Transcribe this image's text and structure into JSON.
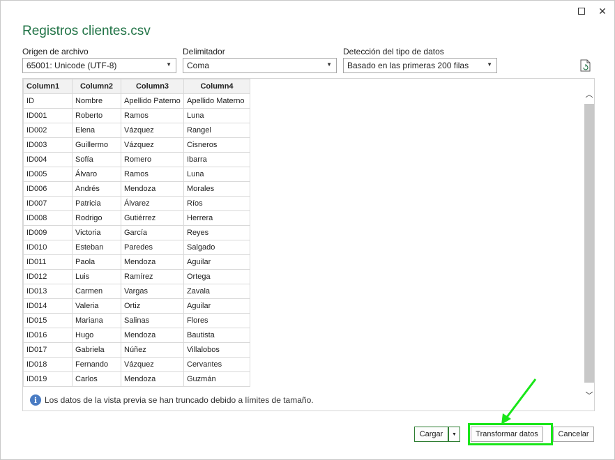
{
  "window": {
    "title": "Registros clientes.csv",
    "maximize_icon": "maximize-icon",
    "close_glyph": "✕"
  },
  "options": {
    "origin_label": "Origen de archivo",
    "origin_value": "65001: Unicode (UTF-8)",
    "delimiter_label": "Delimitador",
    "delimiter_value": "Coma",
    "detection_label": "Detección del tipo de datos",
    "detection_value": "Basado en las primeras 200 filas",
    "caret_glyph": "▼"
  },
  "table": {
    "headers": [
      "Column1",
      "Column2",
      "Column3",
      "Column4"
    ],
    "rows": [
      [
        "ID",
        "Nombre",
        "Apellido Paterno",
        "Apellido Materno"
      ],
      [
        "ID001",
        "Roberto",
        "Ramos",
        "Luna"
      ],
      [
        "ID002",
        "Elena",
        "Vázquez",
        "Rangel"
      ],
      [
        "ID003",
        "Guillermo",
        "Vázquez",
        "Cisneros"
      ],
      [
        "ID004",
        "Sofía",
        "Romero",
        "Ibarra"
      ],
      [
        "ID005",
        "Álvaro",
        "Ramos",
        "Luna"
      ],
      [
        "ID006",
        "Andrés",
        "Mendoza",
        "Morales"
      ],
      [
        "ID007",
        "Patricia",
        "Álvarez",
        "Ríos"
      ],
      [
        "ID008",
        "Rodrigo",
        "Gutiérrez",
        "Herrera"
      ],
      [
        "ID009",
        "Victoria",
        "García",
        "Reyes"
      ],
      [
        "ID010",
        "Esteban",
        "Paredes",
        "Salgado"
      ],
      [
        "ID011",
        "Paola",
        "Mendoza",
        "Aguilar"
      ],
      [
        "ID012",
        "Luis",
        "Ramírez",
        "Ortega"
      ],
      [
        "ID013",
        "Carmen",
        "Vargas",
        "Zavala"
      ],
      [
        "ID014",
        "Valeria",
        "Ortiz",
        "Aguilar"
      ],
      [
        "ID015",
        "Mariana",
        "Salinas",
        "Flores"
      ],
      [
        "ID016",
        "Hugo",
        "Mendoza",
        "Bautista"
      ],
      [
        "ID017",
        "Gabriela",
        "Núñez",
        "Villalobos"
      ],
      [
        "ID018",
        "Fernando",
        "Vázquez",
        "Cervantes"
      ],
      [
        "ID019",
        "Carlos",
        "Mendoza",
        "Guzmán"
      ]
    ]
  },
  "notice": {
    "icon_glyph": "i",
    "text": "Los datos de la vista previa se han truncado debido a límites de tamaño."
  },
  "buttons": {
    "load": "Cargar",
    "load_dropdown": "▼",
    "transform": "Transformar datos",
    "cancel": "Cancelar"
  },
  "scrollbar": {
    "up_glyph": "︿",
    "down_glyph": "﹀"
  },
  "colors": {
    "title_green": "#217346",
    "highlight_green": "#19e619",
    "info_blue": "#4a7cc3"
  }
}
